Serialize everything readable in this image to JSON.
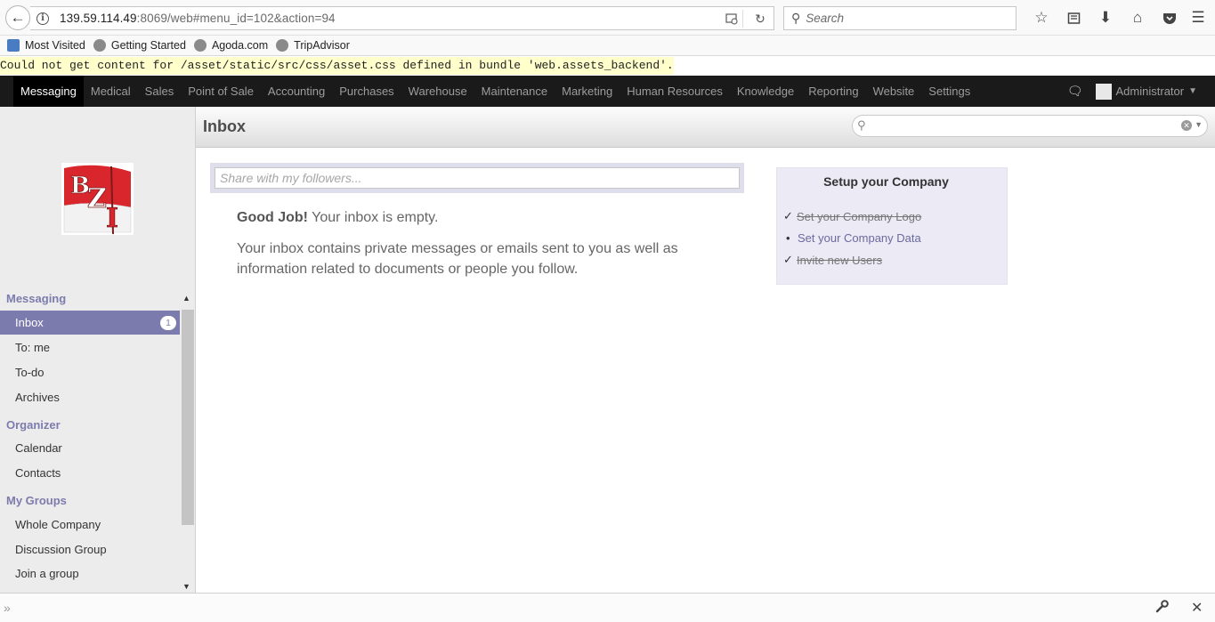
{
  "browser": {
    "url_host": "139.59.114.49",
    "url_rest": ":8069/web#menu_id=102&action=94",
    "search_placeholder": "Search",
    "bookmarks": [
      {
        "label": "Most Visited",
        "icon": "most-visited-icon"
      },
      {
        "label": "Getting Started",
        "icon": "globe-icon"
      },
      {
        "label": "Agoda.com",
        "icon": "globe-icon"
      },
      {
        "label": "TripAdvisor",
        "icon": "globe-icon"
      }
    ]
  },
  "error_message": "Could not get content for /asset/static/src/css/asset.css defined in bundle 'web.assets_backend'.",
  "topnav": {
    "items": [
      "Messaging",
      "Medical",
      "Sales",
      "Point of Sale",
      "Accounting",
      "Purchases",
      "Warehouse",
      "Maintenance",
      "Marketing",
      "Human Resources",
      "Knowledge",
      "Reporting",
      "Website",
      "Settings"
    ],
    "active_index": 0,
    "user": "Administrator"
  },
  "sidebar": {
    "logo_text": "BZI",
    "sections": [
      {
        "title": "Messaging",
        "items": [
          {
            "label": "Inbox",
            "badge": "1",
            "active": true
          },
          {
            "label": "To: me"
          },
          {
            "label": "To-do"
          },
          {
            "label": "Archives"
          }
        ]
      },
      {
        "title": "Organizer",
        "items": [
          {
            "label": "Calendar"
          },
          {
            "label": "Contacts"
          }
        ]
      },
      {
        "title": "My Groups",
        "items": [
          {
            "label": "Whole Company"
          },
          {
            "label": "Discussion Group"
          },
          {
            "label": "Join a group"
          }
        ]
      }
    ]
  },
  "main": {
    "title": "Inbox",
    "share_placeholder": "Share with my followers...",
    "empty_bold": "Good Job!",
    "empty_rest": " Your inbox is empty.",
    "empty_body": "Your inbox contains private messages or emails sent to you as well as information related to documents or people you follow."
  },
  "setup": {
    "title": "Setup your Company",
    "items": [
      {
        "label": "Set your Company Logo",
        "done": true
      },
      {
        "label": "Set your Company Data",
        "done": false
      },
      {
        "label": "Invite new Users",
        "done": true
      }
    ]
  },
  "colors": {
    "accent": "#7c7bad",
    "nav_bg": "#1a1a1a",
    "error_bg": "#ffffcc"
  }
}
